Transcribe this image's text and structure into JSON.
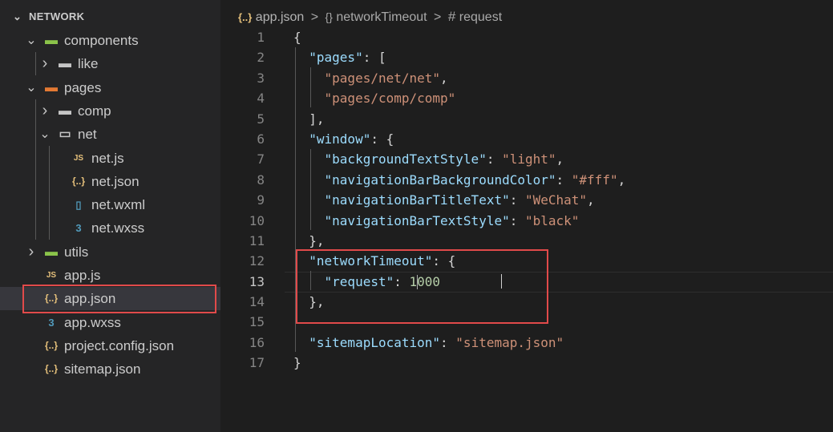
{
  "explorer": {
    "title": "NETWORK",
    "items": [
      {
        "label": "components",
        "icon": "folder-components-icon",
        "chev": "⌄",
        "glyph": "▬",
        "color": "#8bc34a"
      },
      {
        "label": "like",
        "icon": "folder-icon",
        "chev": "›",
        "glyph": "▬",
        "color": "#c5c5c5"
      },
      {
        "label": "pages",
        "icon": "folder-pages-icon",
        "chev": "⌄",
        "glyph": "▬",
        "color": "#e37933"
      },
      {
        "label": "comp",
        "icon": "folder-icon",
        "chev": "›",
        "glyph": "▬",
        "color": "#c5c5c5"
      },
      {
        "label": "net",
        "icon": "folder-open-icon",
        "chev": "⌄",
        "glyph": "▭",
        "color": "#c5c5c5"
      },
      {
        "label": "net.js",
        "icon": "js-file-icon",
        "chev": "",
        "glyph": "JS",
        "color": "#e5c07b"
      },
      {
        "label": "net.json",
        "icon": "json-file-icon",
        "chev": "",
        "glyph": "{..}",
        "color": "#e5c07b"
      },
      {
        "label": "net.wxml",
        "icon": "wxml-file-icon",
        "chev": "",
        "glyph": "▯",
        "color": "#519aba"
      },
      {
        "label": "net.wxss",
        "icon": "css-file-icon",
        "chev": "",
        "glyph": "3",
        "color": "#519aba"
      },
      {
        "label": "utils",
        "icon": "folder-utils-icon",
        "chev": "›",
        "glyph": "▬",
        "color": "#8bc34a"
      },
      {
        "label": "app.js",
        "icon": "js-file-icon",
        "chev": "",
        "glyph": "JS",
        "color": "#e5c07b"
      },
      {
        "label": "app.json",
        "icon": "json-file-icon",
        "chev": "",
        "glyph": "{..}",
        "color": "#e5c07b"
      },
      {
        "label": "app.wxss",
        "icon": "css-file-icon",
        "chev": "",
        "glyph": "3",
        "color": "#519aba"
      },
      {
        "label": "project.config.json",
        "icon": "json-file-icon",
        "chev": "",
        "glyph": "{..}",
        "color": "#e5c07b"
      },
      {
        "label": "sitemap.json",
        "icon": "json-file-icon",
        "chev": "",
        "glyph": "{..}",
        "color": "#e5c07b"
      }
    ]
  },
  "breadcrumb": {
    "file": "app.json",
    "obj": "networkTimeout",
    "prop": "request",
    "sep": ">",
    "file_icon": "{..}",
    "obj_icon": "{}",
    "prop_icon": "#"
  },
  "editor": {
    "active_line": 13,
    "lines": [
      {
        "n": "1",
        "t": [
          [
            "p",
            "{"
          ]
        ]
      },
      {
        "n": "2",
        "t": [
          [
            "p",
            "  "
          ],
          [
            "k",
            "\"pages\""
          ],
          [
            "p",
            ": ["
          ]
        ]
      },
      {
        "n": "3",
        "t": [
          [
            "p",
            "    "
          ],
          [
            "s",
            "\"pages/net/net\""
          ],
          [
            "p",
            ","
          ]
        ]
      },
      {
        "n": "4",
        "t": [
          [
            "p",
            "    "
          ],
          [
            "s",
            "\"pages/comp/comp\""
          ]
        ]
      },
      {
        "n": "5",
        "t": [
          [
            "p",
            "  ],"
          ]
        ]
      },
      {
        "n": "6",
        "t": [
          [
            "p",
            "  "
          ],
          [
            "k",
            "\"window\""
          ],
          [
            "p",
            ": {"
          ]
        ]
      },
      {
        "n": "7",
        "t": [
          [
            "p",
            "    "
          ],
          [
            "k",
            "\"backgroundTextStyle\""
          ],
          [
            "p",
            ": "
          ],
          [
            "s",
            "\"light\""
          ],
          [
            "p",
            ","
          ]
        ]
      },
      {
        "n": "8",
        "t": [
          [
            "p",
            "    "
          ],
          [
            "k",
            "\"navigationBarBackgroundColor\""
          ],
          [
            "p",
            ": "
          ],
          [
            "s",
            "\"#fff\""
          ],
          [
            "p",
            ","
          ]
        ]
      },
      {
        "n": "9",
        "t": [
          [
            "p",
            "    "
          ],
          [
            "k",
            "\"navigationBarTitleText\""
          ],
          [
            "p",
            ": "
          ],
          [
            "s",
            "\"WeChat\""
          ],
          [
            "p",
            ","
          ]
        ]
      },
      {
        "n": "10",
        "t": [
          [
            "p",
            "    "
          ],
          [
            "k",
            "\"navigationBarTextStyle\""
          ],
          [
            "p",
            ": "
          ],
          [
            "s",
            "\"black\""
          ]
        ]
      },
      {
        "n": "11",
        "t": [
          [
            "p",
            "  },"
          ]
        ]
      },
      {
        "n": "12",
        "t": [
          [
            "p",
            "  "
          ],
          [
            "k",
            "\"networkTimeout\""
          ],
          [
            "p",
            ": {"
          ]
        ]
      },
      {
        "n": "13",
        "t": [
          [
            "p",
            "    "
          ],
          [
            "k",
            "\"request\""
          ],
          [
            "p",
            ": "
          ],
          [
            "n",
            "1"
          ],
          [
            "cursor",
            ""
          ],
          [
            "n",
            "000"
          ]
        ]
      },
      {
        "n": "14",
        "t": [
          [
            "p",
            "  },"
          ]
        ]
      },
      {
        "n": "15",
        "t": []
      },
      {
        "n": "16",
        "t": [
          [
            "p",
            "  "
          ],
          [
            "k",
            "\"sitemapLocation\""
          ],
          [
            "p",
            ": "
          ],
          [
            "s",
            "\"sitemap.json\""
          ]
        ]
      },
      {
        "n": "17",
        "t": [
          [
            "p",
            "}"
          ]
        ]
      }
    ]
  },
  "colors": {
    "highlight_box": "#e14a4a",
    "key": "#9cdcfe",
    "string": "#ce9178",
    "number": "#b5cea8"
  }
}
